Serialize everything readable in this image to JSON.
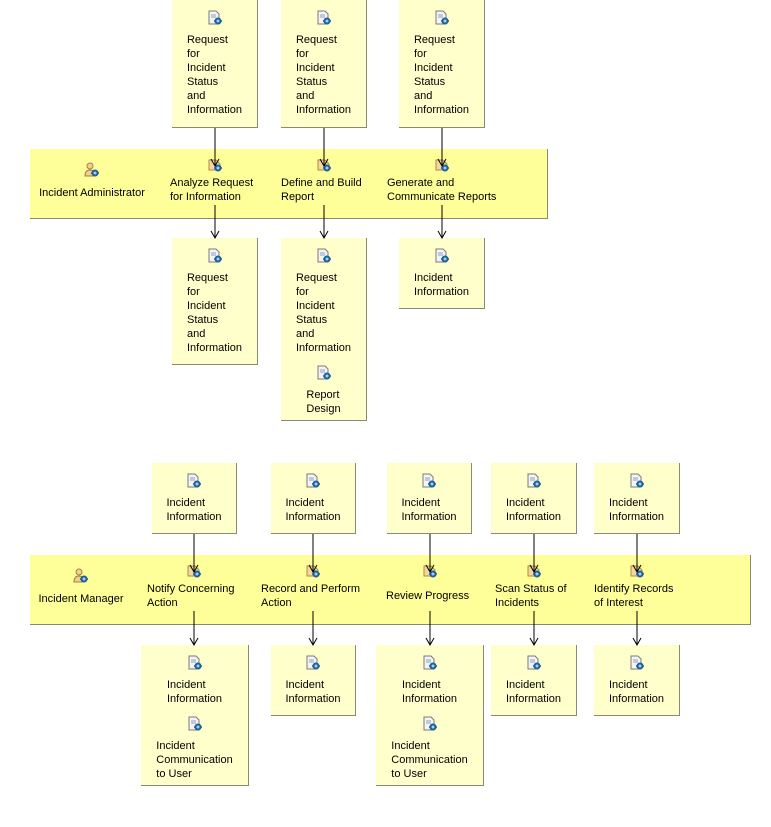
{
  "colors": {
    "lane": "#ffff99",
    "box": "#ffffcc",
    "border": "#8a8a70"
  },
  "lanes": [
    {
      "role": "Incident Administrator",
      "role_icon": "role-icon",
      "activities": [
        {
          "label": "Analyze Request\nfor Information",
          "inputs": [
            {
              "label": "Request\nfor\nIncident\nStatus\nand\nInformation",
              "icon": "artifact-icon"
            }
          ],
          "outputs": [
            {
              "label": "Request\nfor\nIncident\nStatus\nand\nInformation",
              "icon": "artifact-icon"
            }
          ]
        },
        {
          "label": "Define and Build\nReport",
          "inputs": [
            {
              "label": "Request\nfor\nIncident\nStatus\nand\nInformation",
              "icon": "artifact-icon"
            }
          ],
          "outputs": [
            {
              "label": "Request\nfor\nIncident\nStatus\nand\nInformation",
              "icon": "artifact-icon"
            },
            {
              "label": "Report\nDesign",
              "icon": "artifact-icon"
            }
          ]
        },
        {
          "label": "Generate and\nCommunicate Reports",
          "inputs": [
            {
              "label": "Request\nfor\nIncident\nStatus\nand\nInformation",
              "icon": "artifact-icon"
            }
          ],
          "outputs": [
            {
              "label": "Incident\nInformation",
              "icon": "artifact-icon"
            }
          ]
        }
      ]
    },
    {
      "role": "Incident Manager",
      "role_icon": "role-icon",
      "activities": [
        {
          "label": "Notify Concerning\nAction",
          "inputs": [
            {
              "label": "Incident\nInformation",
              "icon": "artifact-icon"
            }
          ],
          "outputs": [
            {
              "label": "Incident\nInformation",
              "icon": "artifact-icon"
            },
            {
              "label": "Incident\nCommunication\nto User",
              "icon": "artifact-icon"
            }
          ]
        },
        {
          "label": "Record and Perform\nAction",
          "inputs": [
            {
              "label": "Incident\nInformation",
              "icon": "artifact-icon"
            }
          ],
          "outputs": [
            {
              "label": "Incident\nInformation",
              "icon": "artifact-icon"
            }
          ]
        },
        {
          "label": "Review Progress",
          "inputs": [
            {
              "label": "Incident\nInformation",
              "icon": "artifact-icon"
            }
          ],
          "outputs": [
            {
              "label": "Incident\nInformation",
              "icon": "artifact-icon"
            },
            {
              "label": "Incident\nCommunication\nto User",
              "icon": "artifact-icon"
            }
          ]
        },
        {
          "label": "Scan Status of\nIncidents",
          "inputs": [
            {
              "label": "Incident\nInformation",
              "icon": "artifact-icon"
            }
          ],
          "outputs": [
            {
              "label": "Incident\nInformation",
              "icon": "artifact-icon"
            }
          ]
        },
        {
          "label": "Identify Records\nof Interest",
          "inputs": [
            {
              "label": "Incident\nInformation",
              "icon": "artifact-icon"
            }
          ],
          "outputs": [
            {
              "label": "Incident\nInformation",
              "icon": "artifact-icon"
            }
          ]
        }
      ]
    }
  ]
}
